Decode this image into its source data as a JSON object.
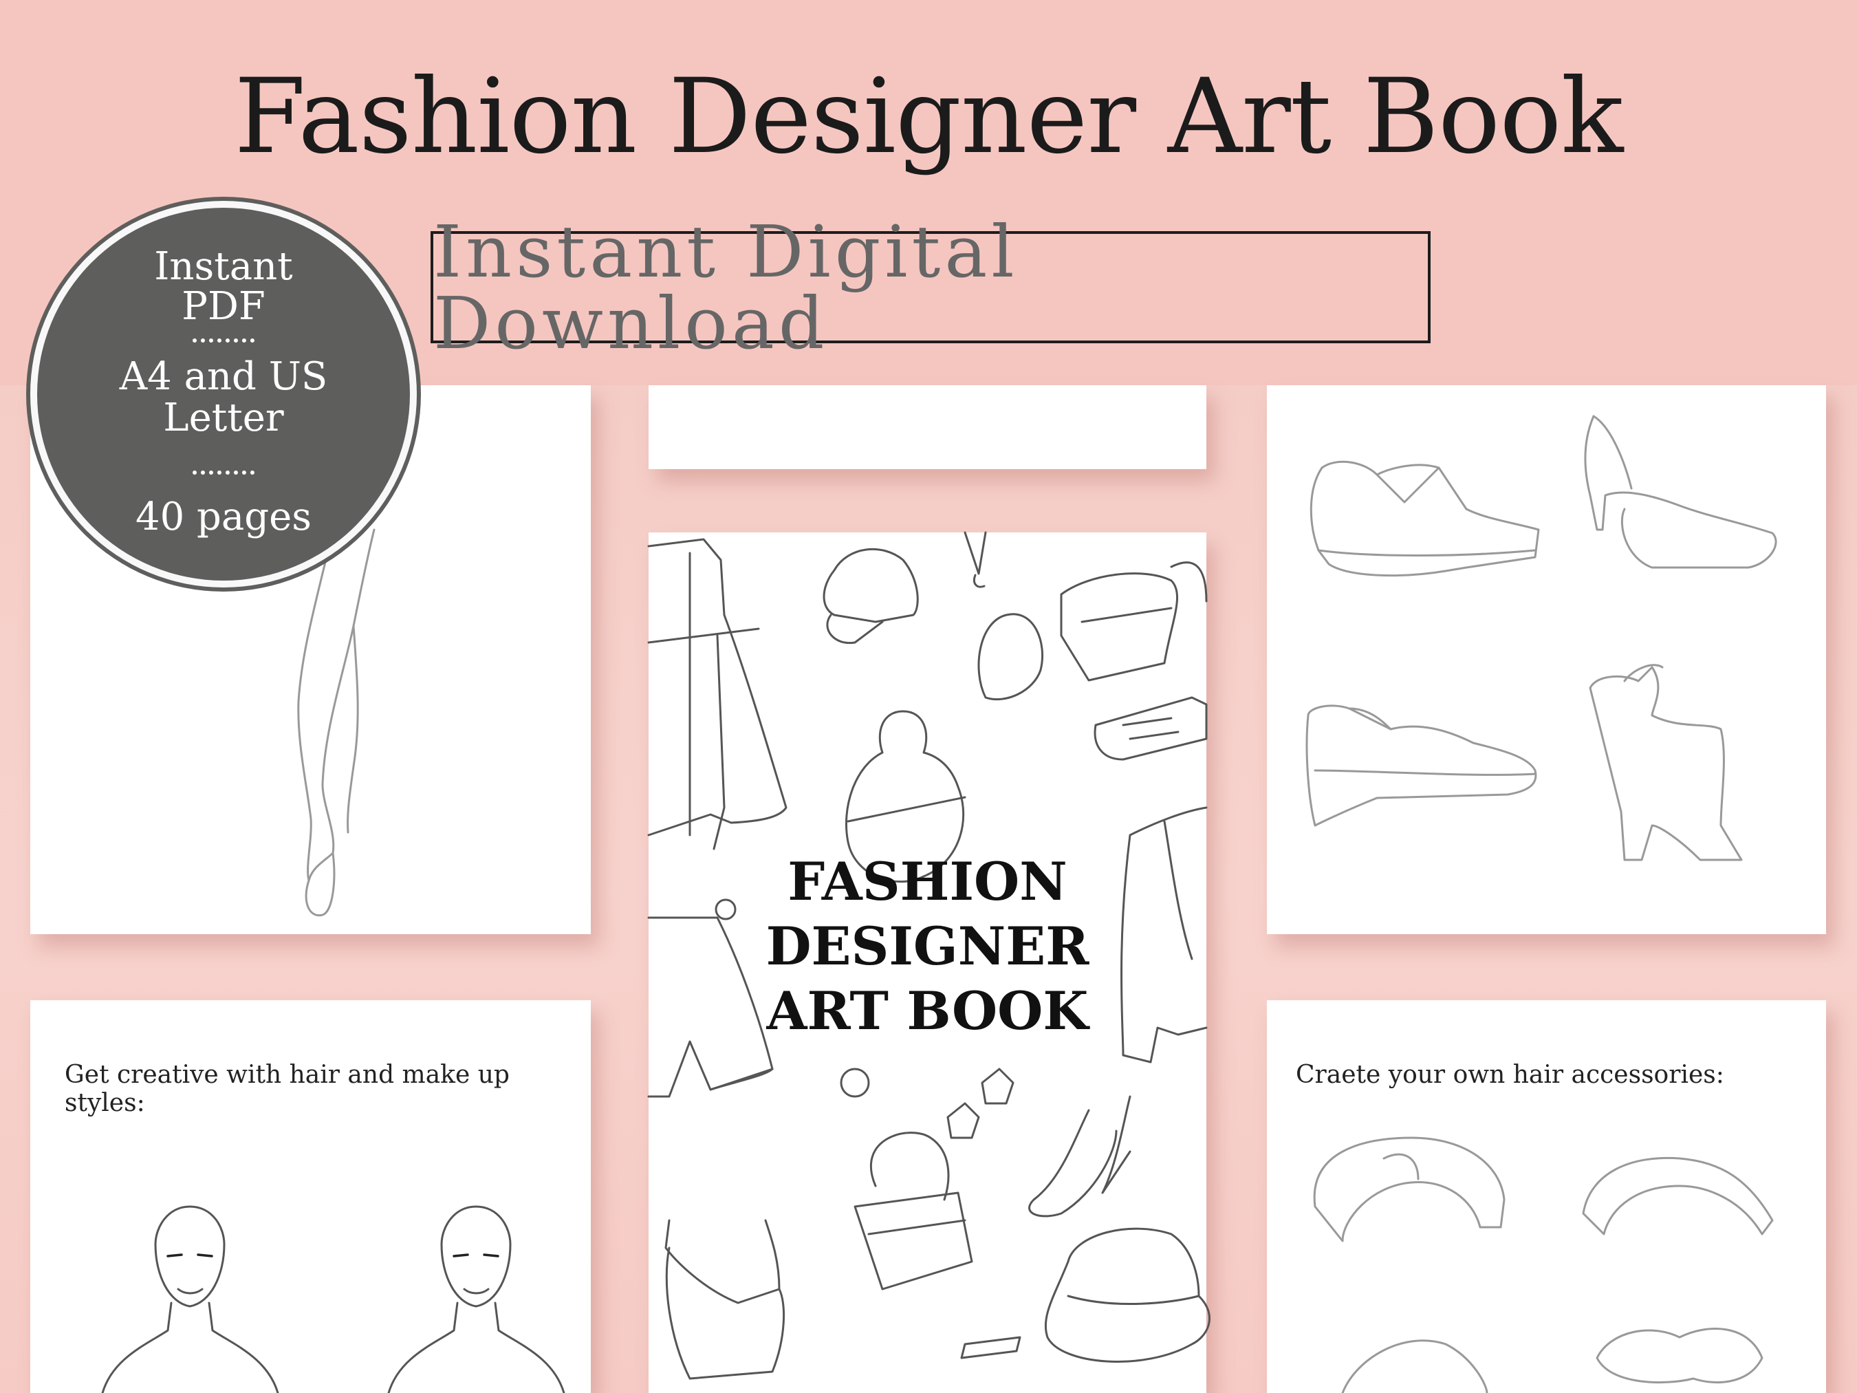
{
  "header": {
    "title": "Fashion Designer Art Book",
    "subtitle": "Instant Digital Download"
  },
  "badge": {
    "line1": "Instant",
    "line2": "PDF",
    "line3": "A4 and US",
    "line4": "Letter",
    "line5": "40 pages"
  },
  "cover": {
    "line1": "FASHION",
    "line2": "DESIGNER",
    "line3": "ART BOOK"
  },
  "pages": {
    "makeup_caption": "Get creative with hair and make up styles:",
    "hair_caption": "Craete your own hair accessories:"
  },
  "colors": {
    "background": "#f5c6c0",
    "badge": "#5e5f5d",
    "title": "#1b1b1b",
    "subtitle": "#666666"
  }
}
